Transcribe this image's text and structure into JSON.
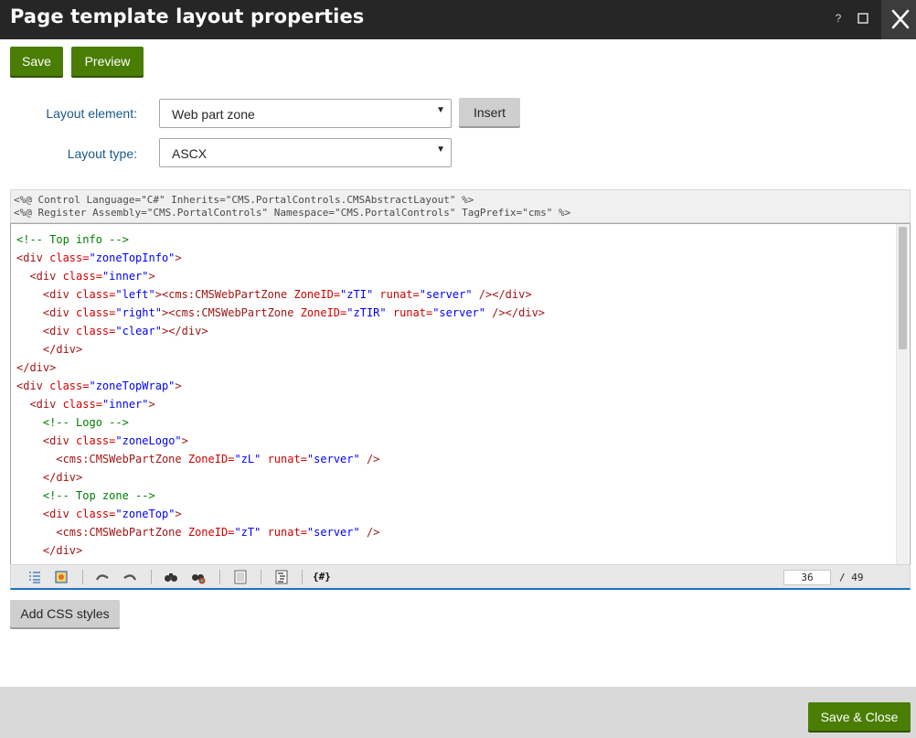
{
  "window": {
    "title": "Page template layout properties",
    "help_glyph": "?"
  },
  "toolbar": {
    "save_label": "Save",
    "preview_label": "Preview"
  },
  "form": {
    "layout_element_label": "Layout element:",
    "layout_element_value": "Web part zone",
    "insert_label": "Insert",
    "layout_type_label": "Layout type:",
    "layout_type_value": "ASCX"
  },
  "code_header": {
    "line1": "<%@ Control Language=\"C#\" Inherits=\"CMS.PortalControls.CMSAbstractLayout\" %>",
    "line2": "<%@ Register Assembly=\"CMS.PortalControls\" Namespace=\"CMS.PortalControls\" TagPrefix=\"cms\" %>"
  },
  "editor": {
    "lines": [
      [
        [
          "c",
          "<!-- Top info -->"
        ]
      ],
      [
        [
          "t",
          "<div "
        ],
        [
          "a",
          "class="
        ],
        [
          "v",
          "\"zoneTopInfo\""
        ],
        [
          "t",
          ">"
        ]
      ],
      [
        [
          "x",
          "  "
        ],
        [
          "t",
          "<div "
        ],
        [
          "a",
          "class="
        ],
        [
          "v",
          "\"inner\""
        ],
        [
          "t",
          ">"
        ]
      ],
      [
        [
          "x",
          "    "
        ],
        [
          "t",
          "<div "
        ],
        [
          "a",
          "class="
        ],
        [
          "v",
          "\"left\""
        ],
        [
          "t",
          "><cms:CMSWebPartZone "
        ],
        [
          "a",
          "ZoneID="
        ],
        [
          "v",
          "\"zTI\""
        ],
        [
          "a",
          " runat="
        ],
        [
          "v",
          "\"server\""
        ],
        [
          "t",
          " /></div>"
        ]
      ],
      [
        [
          "x",
          "    "
        ],
        [
          "t",
          "<div "
        ],
        [
          "a",
          "class="
        ],
        [
          "v",
          "\"right\""
        ],
        [
          "t",
          "><cms:CMSWebPartZone "
        ],
        [
          "a",
          "ZoneID="
        ],
        [
          "v",
          "\"zTIR\""
        ],
        [
          "a",
          " runat="
        ],
        [
          "v",
          "\"server\""
        ],
        [
          "t",
          " /></div>"
        ]
      ],
      [
        [
          "x",
          "    "
        ],
        [
          "t",
          "<div "
        ],
        [
          "a",
          "class="
        ],
        [
          "v",
          "\"clear\""
        ],
        [
          "t",
          "></div>"
        ]
      ],
      [
        [
          "x",
          "    "
        ],
        [
          "t",
          "</div>"
        ]
      ],
      [
        [
          "t",
          "</div>"
        ]
      ],
      [
        [
          "t",
          "<div "
        ],
        [
          "a",
          "class="
        ],
        [
          "v",
          "\"zoneTopWrap\""
        ],
        [
          "t",
          ">"
        ]
      ],
      [
        [
          "x",
          "  "
        ],
        [
          "t",
          "<div "
        ],
        [
          "a",
          "class="
        ],
        [
          "v",
          "\"inner\""
        ],
        [
          "t",
          ">"
        ]
      ],
      [
        [
          "x",
          "    "
        ],
        [
          "c",
          "<!-- Logo -->"
        ]
      ],
      [
        [
          "x",
          "    "
        ],
        [
          "t",
          "<div "
        ],
        [
          "a",
          "class="
        ],
        [
          "v",
          "\"zoneLogo\""
        ],
        [
          "t",
          ">"
        ]
      ],
      [
        [
          "x",
          "      "
        ],
        [
          "t",
          "<cms:CMSWebPartZone "
        ],
        [
          "a",
          "ZoneID="
        ],
        [
          "v",
          "\"zL\""
        ],
        [
          "a",
          " runat="
        ],
        [
          "v",
          "\"server\""
        ],
        [
          "t",
          " />"
        ]
      ],
      [
        [
          "x",
          "    "
        ],
        [
          "t",
          "</div>"
        ]
      ],
      [
        [
          "x",
          "    "
        ],
        [
          "c",
          "<!-- Top zone -->"
        ]
      ],
      [
        [
          "x",
          "    "
        ],
        [
          "t",
          "<div "
        ],
        [
          "a",
          "class="
        ],
        [
          "v",
          "\"zoneTop\""
        ],
        [
          "t",
          ">"
        ]
      ],
      [
        [
          "x",
          "      "
        ],
        [
          "t",
          "<cms:CMSWebPartZone "
        ],
        [
          "a",
          "ZoneID="
        ],
        [
          "v",
          "\"zT\""
        ],
        [
          "a",
          " runat="
        ],
        [
          "v",
          "\"server\""
        ],
        [
          "t",
          " />"
        ]
      ],
      [
        [
          "x",
          "    "
        ],
        [
          "t",
          "</div>"
        ]
      ]
    ],
    "current_line": "36",
    "total_lines": "/ 49"
  },
  "code_toolbar": {
    "macro_label": "{#}"
  },
  "add_css_label": "Add CSS styles",
  "footer": {
    "save_close_label": "Save & Close"
  },
  "colors": {
    "titlebar": "#262626",
    "accent_green": "#497d04",
    "label_blue": "#1a5a8a",
    "code_tag": "#a31515",
    "code_attr": "#d40000",
    "code_value": "#0000ff",
    "code_comment": "#008000",
    "footer": "#d9d9d9"
  },
  "icons": [
    "line-numbers-icon",
    "highlight-toggle-icon",
    "undo-icon",
    "redo-icon",
    "find-icon",
    "replace-icon",
    "fullscreen-icon",
    "format-icon",
    "macro-icon"
  ]
}
